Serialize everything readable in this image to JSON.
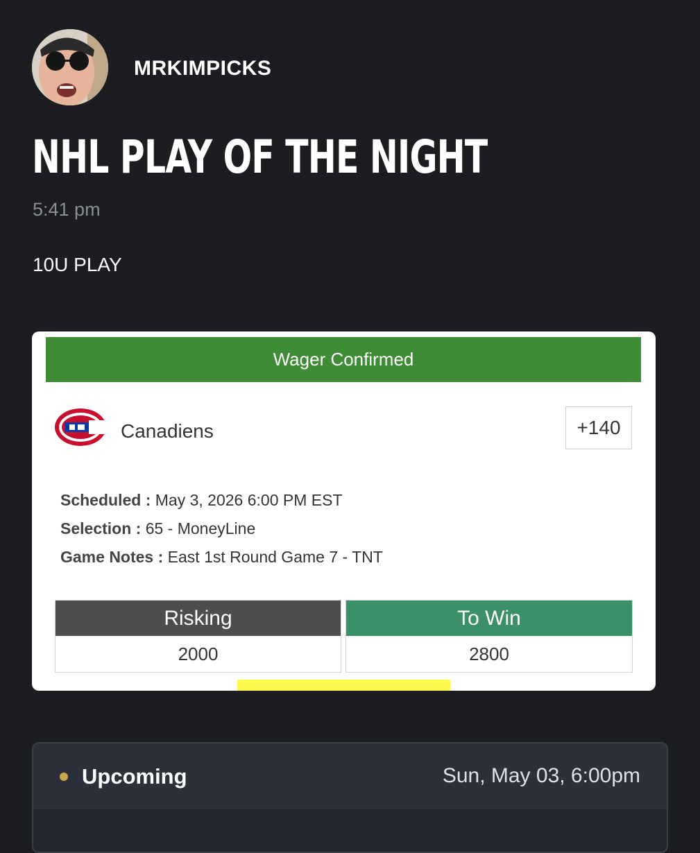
{
  "post": {
    "username": "MRKIMPICKS",
    "title": "NHL PLAY OF THE NIGHT",
    "time": "5:41 pm",
    "body": "10U PLAY"
  },
  "ticket": {
    "header": "Wager Confirmed",
    "team": "Canadiens",
    "team_logo_icon": "canadiens-logo-icon",
    "odds": "+140",
    "scheduled_label": "Scheduled :",
    "scheduled_value": "May 3, 2026 6:00 PM EST",
    "selection_label": "Selection :",
    "selection_value": "65 - MoneyLine",
    "notes_label": "Game Notes :",
    "notes_value": "East 1st Round Game 7 - TNT",
    "risking_label": "Risking",
    "risking_value": "2000",
    "towin_label": "To Win",
    "towin_value": "2800",
    "colors": {
      "header": "#3e8c36",
      "risking": "#4d4d4d",
      "to_win": "#3c9068",
      "highlight": "#fbf94c"
    }
  },
  "status": {
    "label": "Upcoming",
    "date": "Sun, May 03, 6:00pm",
    "dot_color": "#c9a94c"
  }
}
